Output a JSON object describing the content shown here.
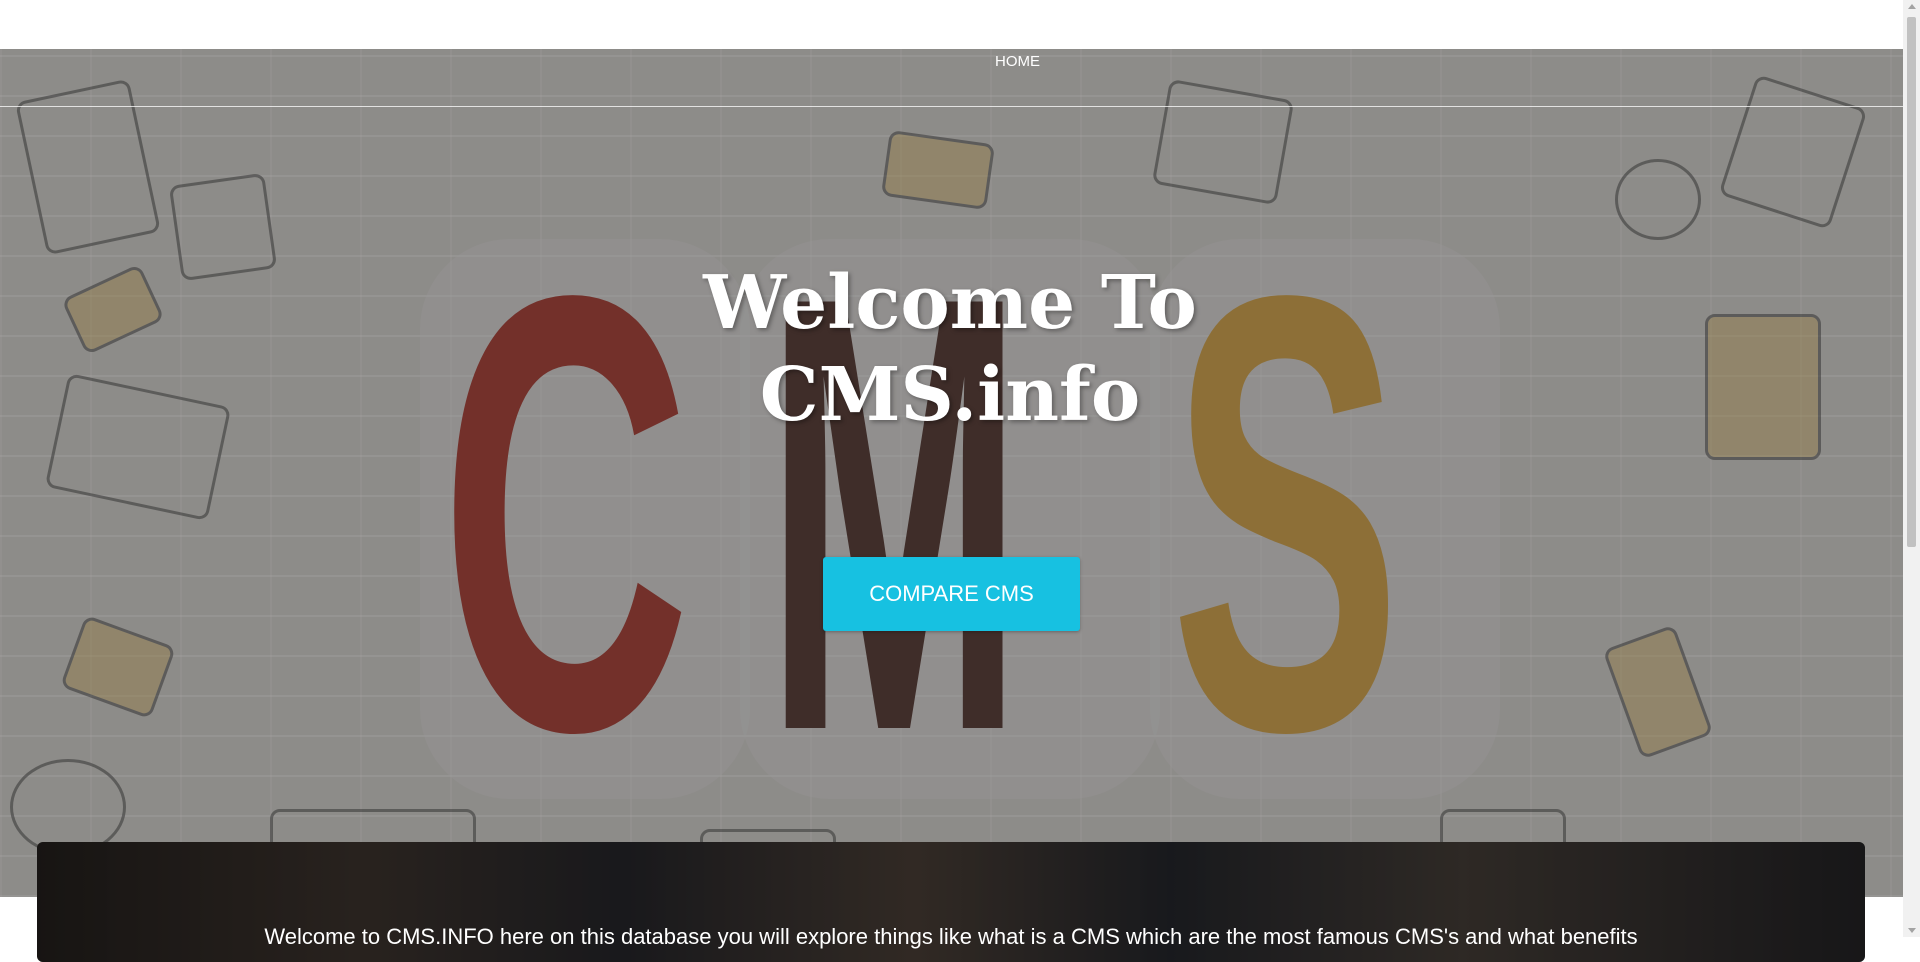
{
  "nav": {
    "home_label": "HOME"
  },
  "hero": {
    "backdrop_letters": [
      "C",
      "M",
      "S"
    ],
    "heading_line1": "Welcome To",
    "heading_line2": "CMS.info",
    "compare_button_label": "COMPARE CMS"
  },
  "intro": {
    "text": "Welcome to CMS.INFO here on this database you will explore things like what is a CMS which are the most famous CMS's and what benefits"
  },
  "colors": {
    "button": "#17c1e1",
    "letter_c": "#8e2219",
    "letter_m": "#3b1d17",
    "letter_s": "#b8882e",
    "nav_text": "#ffffff"
  }
}
